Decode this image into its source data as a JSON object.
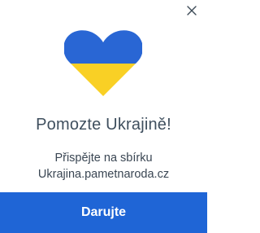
{
  "popup": {
    "close_icon": "close-icon",
    "heart_icon": "ukraine-flag-heart-icon",
    "colors": {
      "heart_blue": "#2966d4",
      "heart_yellow": "#f9d025",
      "button_bg": "#1f65d6",
      "title_text": "#3f4f5e"
    },
    "title": "Pomozte Ukrajině!",
    "subtitle_line1": "Přispějte na sbírku",
    "subtitle_line2": "Ukrajina.pametnaroda.cz",
    "button_label": "Darujte"
  }
}
